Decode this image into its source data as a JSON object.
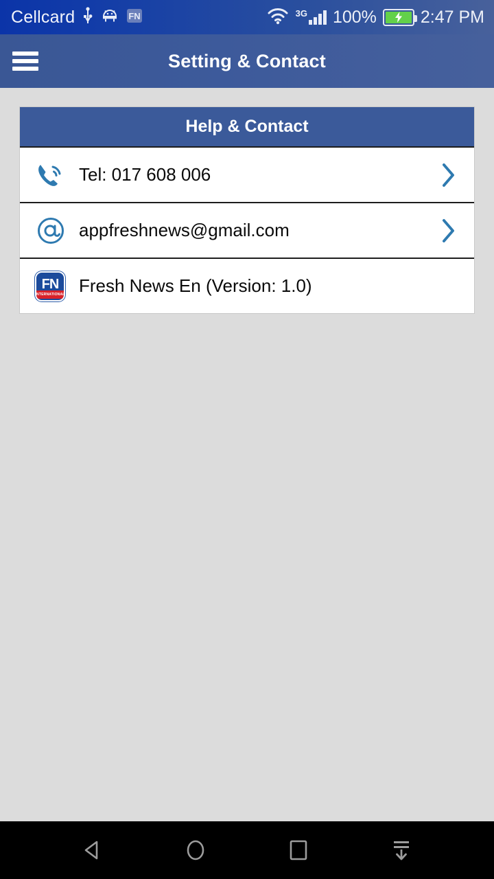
{
  "status_bar": {
    "carrier": "Cellcard",
    "icons": [
      "usb-icon",
      "android-robot-icon",
      "fn-app-notification-icon",
      "wifi-icon",
      "signal-bars-icon"
    ],
    "network_type": "3G",
    "battery_percent": "100%",
    "battery_state": "charging",
    "time": "2:47 PM"
  },
  "app_bar": {
    "menu_icon": "hamburger-menu-icon",
    "title": "Setting & Contact"
  },
  "card": {
    "header": "Help & Contact",
    "rows": [
      {
        "icon": "phone-call-icon",
        "label": "Tel: 017 608 006",
        "chevron": "chevron-right-icon",
        "has_chevron": true
      },
      {
        "icon": "at-sign-icon",
        "label": "appfreshnews@gmail.com",
        "chevron": "chevron-right-icon",
        "has_chevron": true
      },
      {
        "icon": "fresh-news-app-logo",
        "label": "Fresh News En (Version: 1.0)",
        "chevron": "",
        "has_chevron": false
      }
    ]
  },
  "app_logo": {
    "letters": "FN",
    "banner": "INTERNATIONAL"
  },
  "nav_bar": {
    "buttons": [
      {
        "name": "back-button",
        "icon": "back-triangle-icon"
      },
      {
        "name": "home-button",
        "icon": "home-circle-icon"
      },
      {
        "name": "recents-button",
        "icon": "recents-square-icon"
      },
      {
        "name": "notification-pulldown-button",
        "icon": "pull-down-arrow-icon"
      }
    ]
  },
  "colors": {
    "status_bar_blue": "#123ca8",
    "app_bar_blue": "#3d5a9b",
    "card_header_blue": "#3b5a9a",
    "page_background": "#dcdcdc",
    "accent_icon_blue": "#2e7ab0",
    "battery_green": "#63d14a",
    "logo_red": "#d8222a"
  }
}
